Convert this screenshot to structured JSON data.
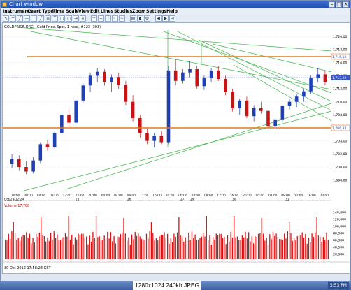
{
  "window": {
    "title": "Chart window"
  },
  "menu": [
    "Instruments",
    "Chart Type",
    "Time Scale",
    "View",
    "Edit",
    "Lines",
    "Studies",
    "Zoom",
    "Settings",
    "Help"
  ],
  "chart": {
    "header": "GOLDPRICE.ORG - Gold Price, Spot, 1 hour, #123 (303)",
    "price_labels": [
      "1,720,00",
      "1,718,00",
      "1,716,00",
      "1,714,00",
      "1,712,00",
      "1,710,00",
      "1,708,00",
      "1,706,00",
      "1,704,00",
      "1,702,00",
      "1,700,00",
      "1,698,00"
    ],
    "marker_top": "1,715,10",
    "marker_mid": "1,713,22",
    "marker_low": "1,706,34",
    "time_labels": [
      "20:00",
      "00:00",
      "04:00",
      "08:00",
      "12:00",
      "16:00",
      "20:00",
      "00:00",
      "04:00",
      "08:00",
      "12:00",
      "16:00",
      "20:00",
      "00:00",
      "04:00",
      "08:00",
      "12:00",
      "16:00",
      "20:00",
      "00:00",
      "04:00",
      "08:00",
      "12:00",
      "16:00",
      "20:00"
    ],
    "date_labels": [
      "Oct/23/12:24",
      "25",
      "26",
      "27",
      "29",
      "30",
      "31"
    ],
    "volume_header": "Volume 17,708",
    "volume_labels": [
      "140,000",
      "120,000",
      "100,000",
      "80,000",
      "60,000",
      "40,000",
      "20,000"
    ],
    "bottom_left": "30 Oct 2012 17:58:28 GST"
  },
  "chart_data": {
    "type": "candlestick",
    "unit": "USD/oz",
    "ylim": [
      1697,
      1721
    ],
    "candles": [
      [
        1700.5,
        1702.0,
        1699.8,
        1701.2
      ],
      [
        1701.2,
        1701.8,
        1699.5,
        1700.0
      ],
      [
        1700.0,
        1700.9,
        1698.9,
        1699.3
      ],
      [
        1699.3,
        1701.5,
        1699.0,
        1701.0
      ],
      [
        1701.0,
        1703.8,
        1700.6,
        1703.5
      ],
      [
        1703.5,
        1704.2,
        1702.5,
        1703.0
      ],
      [
        1703.0,
        1705.5,
        1702.8,
        1705.2
      ],
      [
        1705.2,
        1708.5,
        1705.0,
        1708.0
      ],
      [
        1708.0,
        1709.0,
        1706.0,
        1706.8
      ],
      [
        1706.8,
        1710.5,
        1706.5,
        1710.2
      ],
      [
        1710.2,
        1712.8,
        1709.8,
        1712.5
      ],
      [
        1712.5,
        1714.5,
        1711.5,
        1714.0
      ],
      [
        1714.0,
        1715.2,
        1713.0,
        1714.6
      ],
      [
        1714.6,
        1715.0,
        1712.5,
        1713.0
      ],
      [
        1713.0,
        1714.2,
        1711.5,
        1713.8
      ],
      [
        1713.8,
        1714.5,
        1712.0,
        1712.6
      ],
      [
        1712.6,
        1713.2,
        1709.5,
        1710.0
      ],
      [
        1710.0,
        1711.0,
        1707.0,
        1707.5
      ],
      [
        1707.5,
        1708.0,
        1704.5,
        1705.2
      ],
      [
        1705.2,
        1706.0,
        1703.5,
        1704.0
      ],
      [
        1704.0,
        1705.2,
        1703.0,
        1704.8
      ],
      [
        1704.8,
        1705.5,
        1703.5,
        1703.8
      ],
      [
        1703.8,
        1715.5,
        1703.5,
        1714.8
      ],
      [
        1714.8,
        1716.5,
        1712.5,
        1713.2
      ],
      [
        1713.2,
        1715.0,
        1712.8,
        1714.5
      ],
      [
        1714.5,
        1716.2,
        1713.8,
        1715.0
      ],
      [
        1715.0,
        1715.5,
        1712.0,
        1712.4
      ],
      [
        1712.4,
        1714.0,
        1711.8,
        1713.6
      ],
      [
        1713.6,
        1715.2,
        1713.0,
        1714.8
      ],
      [
        1714.8,
        1715.5,
        1713.2,
        1713.5
      ],
      [
        1713.5,
        1714.0,
        1711.0,
        1711.5
      ],
      [
        1711.5,
        1712.0,
        1708.5,
        1709.0
      ],
      [
        1709.0,
        1710.5,
        1708.0,
        1710.2
      ],
      [
        1710.2,
        1710.8,
        1707.5,
        1707.8
      ],
      [
        1707.8,
        1709.5,
        1707.0,
        1709.0
      ],
      [
        1709.0,
        1710.0,
        1708.2,
        1708.6
      ],
      [
        1708.6,
        1709.0,
        1705.5,
        1706.2
      ],
      [
        1706.2,
        1707.5,
        1705.8,
        1707.2
      ],
      [
        1707.2,
        1709.5,
        1707.0,
        1709.4
      ],
      [
        1709.4,
        1710.5,
        1708.8,
        1710.0
      ],
      [
        1710.0,
        1711.2,
        1709.2,
        1710.8
      ],
      [
        1710.8,
        1712.0,
        1710.0,
        1711.6
      ],
      [
        1711.6,
        1714.0,
        1711.2,
        1713.6
      ],
      [
        1713.6,
        1715.2,
        1713.0,
        1714.2
      ],
      [
        1714.2,
        1714.8,
        1712.6,
        1713.0
      ]
    ]
  }
}
